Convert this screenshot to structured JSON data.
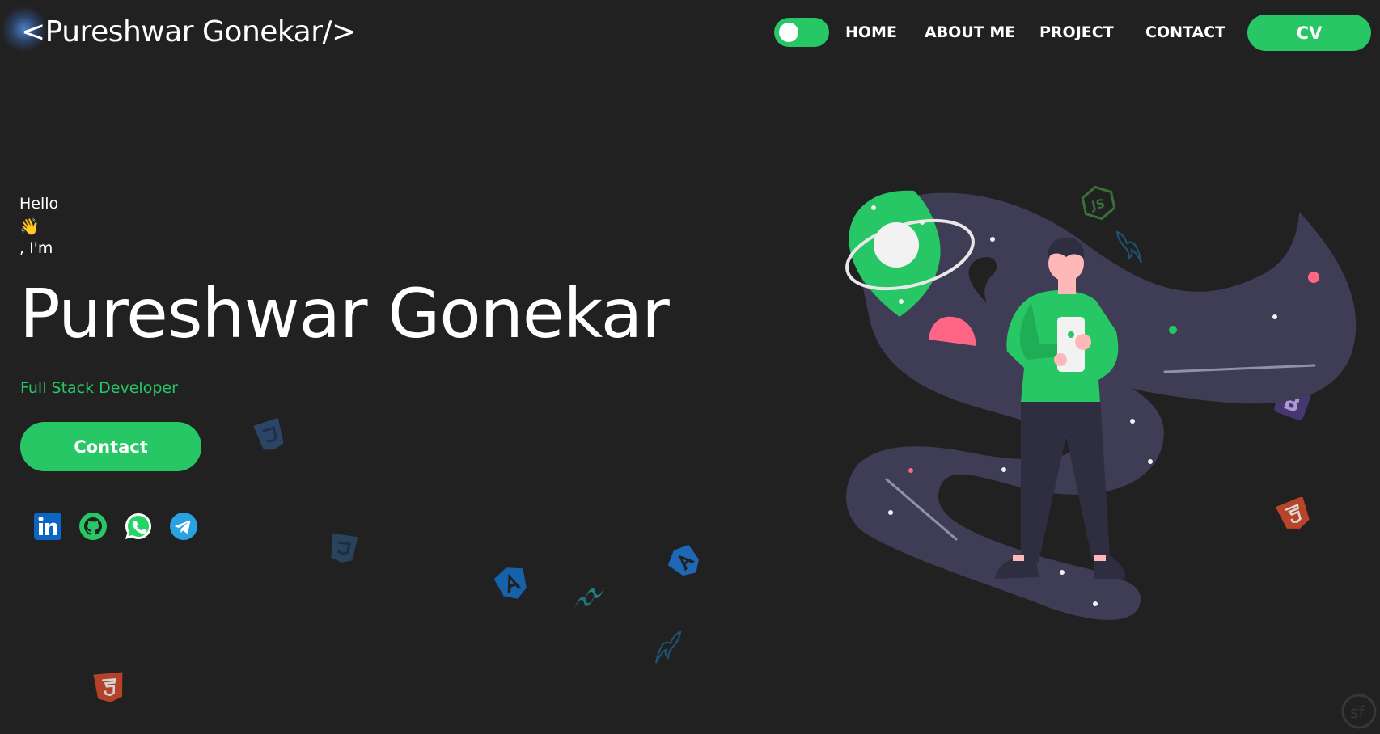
{
  "header": {
    "logo": "<Pureshwar Gonekar/>",
    "nav": [
      "HOME",
      "ABOUT ME",
      "PROJECT",
      "CONTACT"
    ],
    "cv_label": "CV",
    "theme_toggle_on": true
  },
  "hero": {
    "greeting": "Hello",
    "wave_emoji": "👋",
    "im": ", I'm",
    "name": "Pureshwar Gonekar",
    "role": "Full Stack Developer",
    "contact_label": "Contact"
  },
  "social": [
    "linkedin-icon",
    "github-icon",
    "whatsapp-icon",
    "telegram-icon"
  ],
  "colors": {
    "background": "#212121",
    "accent": "#26c764",
    "text": "#ffffff",
    "illustration_path": "#3f3d56",
    "pink": "#ff6584"
  }
}
